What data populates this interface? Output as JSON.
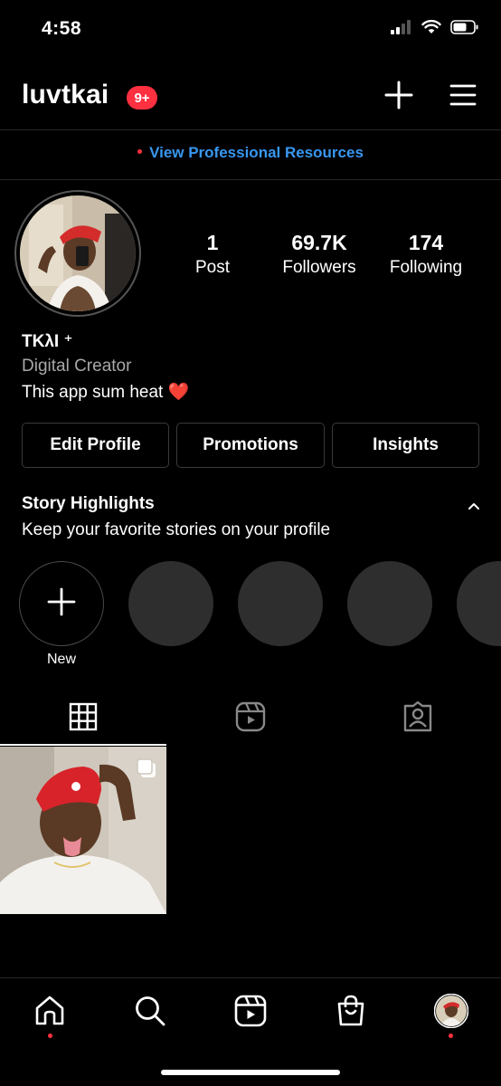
{
  "status_bar": {
    "time": "4:58",
    "signal_icon": "signal-icon",
    "wifi_icon": "wifi-icon",
    "battery_icon": "battery-icon"
  },
  "header": {
    "username": "luvtkai",
    "notification_badge": "9+",
    "create_icon": "plus-icon",
    "menu_icon": "hamburger-menu-icon"
  },
  "professional": {
    "link_text": "View Professional Resources"
  },
  "profile": {
    "stats": [
      {
        "value": "1",
        "label": "Post"
      },
      {
        "value": "69.7K",
        "label": "Followers"
      },
      {
        "value": "174",
        "label": "Following"
      }
    ],
    "display_name": "ΤΚλΙ ⁺",
    "category": "Digital Creator",
    "bio": "This app sum heat ❤️"
  },
  "actions": {
    "edit_profile": "Edit Profile",
    "promotions": "Promotions",
    "insights": "Insights"
  },
  "highlights": {
    "title": "Story Highlights",
    "subtitle": "Keep your favorite stories on your profile",
    "new_label": "New"
  },
  "tabs": [
    {
      "icon": "grid-icon",
      "active": true
    },
    {
      "icon": "reels-icon",
      "active": false
    },
    {
      "icon": "tagged-icon",
      "active": false
    }
  ],
  "bottom_nav": [
    {
      "icon": "home-icon",
      "has_dot": true
    },
    {
      "icon": "search-icon",
      "has_dot": false
    },
    {
      "icon": "reels-icon",
      "has_dot": false
    },
    {
      "icon": "shop-icon",
      "has_dot": false
    },
    {
      "icon": "profile-avatar-icon",
      "has_dot": true
    }
  ],
  "colors": {
    "background": "#000000",
    "link": "#3897f0",
    "badge": "#ff3040",
    "placeholder": "#2e2e2e",
    "muted_text": "#a8a8a8"
  }
}
